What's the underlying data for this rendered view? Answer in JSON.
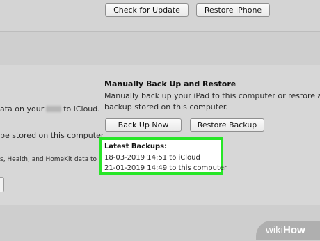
{
  "top_buttons": {
    "check_update": "Check for Update",
    "restore_iphone": "Restore iPhone"
  },
  "icloud_section": {
    "line1_pre": "ata on your",
    "line1_post": "to iCloud.",
    "line2": "be stored on this computer.",
    "line3": "s, Health, and HomeKit data to be"
  },
  "manual_backup": {
    "title": "Manually Back Up and Restore",
    "description_line1": "Manually back up your iPad to this computer or restore a",
    "description_line2": "backup stored on this computer.",
    "back_up_now": "Back Up Now",
    "restore_backup": "Restore Backup"
  },
  "latest_backups": {
    "title": "Latest Backups:",
    "entries": [
      "18-03-2019 14:51 to iCloud",
      "21-01-2019 14:49 to this computer"
    ]
  },
  "watermark": {
    "part1": "wiki",
    "part2": "How"
  },
  "colors": {
    "highlight": "#27e627",
    "background": "#d6d6d6"
  }
}
